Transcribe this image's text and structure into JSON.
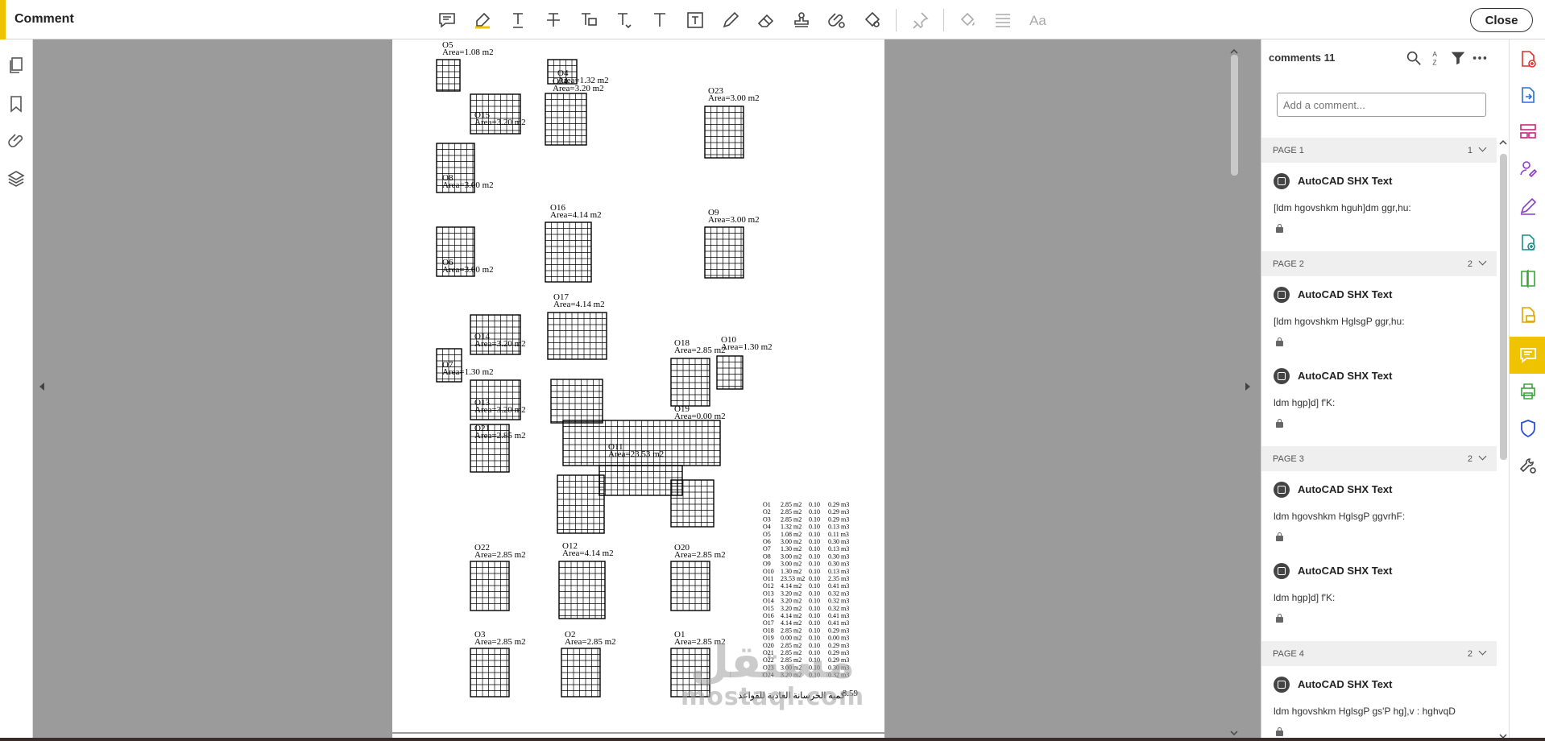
{
  "toolbar": {
    "title": "Comment",
    "close_label": "Close",
    "tools": [
      "sticky-note-icon",
      "highlight-icon",
      "underline-text-icon",
      "strikethrough-text-icon",
      "replace-text-icon",
      "insert-text-icon",
      "add-text-icon",
      "text-box-icon",
      "draw-icon",
      "eraser-icon",
      "stamp-icon",
      "attach-icon",
      "shapes-icon",
      "pin-icon",
      "fill-icon",
      "lines-icon",
      "font-size-icon"
    ]
  },
  "left_rail": [
    "pages-icon",
    "bookmark-icon",
    "attachment-icon",
    "layers-icon"
  ],
  "document": {
    "footprints": [
      {
        "id": "O5",
        "area": "Area=1.08 m2"
      },
      {
        "id": "O4",
        "area": "Area=1.32 m2"
      },
      {
        "id": "O24",
        "area": "Area=3.20 m2"
      },
      {
        "id": "O23",
        "area": "Area=3.00 m2"
      },
      {
        "id": "O15",
        "area": "Area=3.20 m2"
      },
      {
        "id": "O8",
        "area": "Area=3.00 m2"
      },
      {
        "id": "O16",
        "area": "Area=4.14 m2"
      },
      {
        "id": "O9",
        "area": "Area=3.00 m2"
      },
      {
        "id": "O6",
        "area": "Area=3.00 m2"
      },
      {
        "id": "O17",
        "area": "Area=4.14 m2"
      },
      {
        "id": "O14",
        "area": "Area=3.20 m2"
      },
      {
        "id": "O18",
        "area": "Area=2.85 m2"
      },
      {
        "id": "O10",
        "area": "Area=1.30 m2"
      },
      {
        "id": "O7",
        "area": "Area=1.30 m2"
      },
      {
        "id": "O13",
        "area": "Area=3.20 m2"
      },
      {
        "id": "O19",
        "area": "Area=0.00 m2"
      },
      {
        "id": "O21",
        "area": "Area=2.85 m2"
      },
      {
        "id": "O11",
        "area": "Area=23.53 m2"
      },
      {
        "id": "O22",
        "area": "Area=2.85 m2"
      },
      {
        "id": "O12",
        "area": "Area=4.14 m2"
      },
      {
        "id": "O20",
        "area": "Area=2.85 m2"
      },
      {
        "id": "O3",
        "area": "Area=2.85 m2"
      },
      {
        "id": "O2",
        "area": "Area=2.85 m2"
      },
      {
        "id": "O1",
        "area": "Area=2.85 m2"
      }
    ],
    "quantity_table": [
      [
        "O1",
        "2.85 m2",
        "0.10",
        "0.29 m3"
      ],
      [
        "O2",
        "2.85 m2",
        "0.10",
        "0.29 m3"
      ],
      [
        "O3",
        "2.85 m2",
        "0.10",
        "0.29 m3"
      ],
      [
        "O4",
        "1.32 m2",
        "0.10",
        "0.13 m3"
      ],
      [
        "O5",
        "1.08 m2",
        "0.10",
        "0.11 m3"
      ],
      [
        "O6",
        "3.00 m2",
        "0.10",
        "0.30 m3"
      ],
      [
        "O7",
        "1.30 m2",
        "0.10",
        "0.13 m3"
      ],
      [
        "O8",
        "3.00 m2",
        "0.10",
        "0.30 m3"
      ],
      [
        "O9",
        "3.00 m2",
        "0.10",
        "0.30 m3"
      ],
      [
        "O10",
        "1.30 m2",
        "0.10",
        "0.13 m3"
      ],
      [
        "O11",
        "23.53 m2",
        "0.10",
        "2.35 m3"
      ],
      [
        "O12",
        "4.14 m2",
        "0.10",
        "0.41 m3"
      ],
      [
        "O13",
        "3.20 m2",
        "0.10",
        "0.32 m3"
      ],
      [
        "O14",
        "3.20 m2",
        "0.10",
        "0.32 m3"
      ],
      [
        "O15",
        "3.20 m2",
        "0.10",
        "0.32 m3"
      ],
      [
        "O16",
        "4.14 m2",
        "0.10",
        "0.41 m3"
      ],
      [
        "O17",
        "4.14 m2",
        "0.10",
        "0.41 m3"
      ],
      [
        "O18",
        "2.85 m2",
        "0.10",
        "0.29 m3"
      ],
      [
        "O19",
        "0.00 m2",
        "0.10",
        "0.00 m3"
      ],
      [
        "O20",
        "2.85 m2",
        "0.10",
        "0.29 m3"
      ],
      [
        "O21",
        "2.85 m2",
        "0.10",
        "0.29 m3"
      ],
      [
        "O22",
        "2.85 m2",
        "0.10",
        "0.29 m3"
      ],
      [
        "O23",
        "3.00 m2",
        "0.10",
        "0.30 m3"
      ],
      [
        "O24",
        "3.20 m2",
        "0.10",
        "0.32 m3"
      ]
    ],
    "total_label": "كمية الخرسانة العادية للقواعد",
    "total_value": "8.59",
    "watermark_ar": "مستقل",
    "watermark_en": "mostaql.com"
  },
  "comments_panel": {
    "title": "comments 11",
    "add_placeholder": "Add a comment...",
    "pages": [
      {
        "label": "PAGE 1",
        "count": "1",
        "comments": [
          {
            "author": "AutoCAD SHX Text",
            "text": "[ldm hgovshkm hguh]dm ggr,hu:"
          }
        ]
      },
      {
        "label": "PAGE 2",
        "count": "2",
        "comments": [
          {
            "author": "AutoCAD SHX Text",
            "text": "[ldm hgovshkm HglsgP ggr,hu:"
          },
          {
            "author": "AutoCAD SHX Text",
            "text": "ldm hgp]d] f'K:"
          }
        ]
      },
      {
        "label": "PAGE 3",
        "count": "2",
        "comments": [
          {
            "author": "AutoCAD SHX Text",
            "text": "ldm hgovshkm HglsgP ggvrhF:"
          },
          {
            "author": "AutoCAD SHX Text",
            "text": "ldm hgp]d] f'K:"
          }
        ]
      },
      {
        "label": "PAGE 4",
        "count": "2",
        "comments": [
          {
            "author": "AutoCAD SHX Text",
            "text": "ldm hgovshkm HglsgP gs'P hg],v : hghvqD"
          }
        ]
      }
    ]
  },
  "right_rail": [
    "create-pdf-icon",
    "export-pdf-icon",
    "organize-pages-icon",
    "request-signature-icon",
    "fill-sign-icon",
    "add-file-icon",
    "compare-icon",
    "scan-icon",
    "comment-icon",
    "print-production-icon",
    "protect-icon",
    "more-tools-icon"
  ],
  "colors": {
    "accent": "#f0c300",
    "workspace": "#9b9b9b"
  }
}
